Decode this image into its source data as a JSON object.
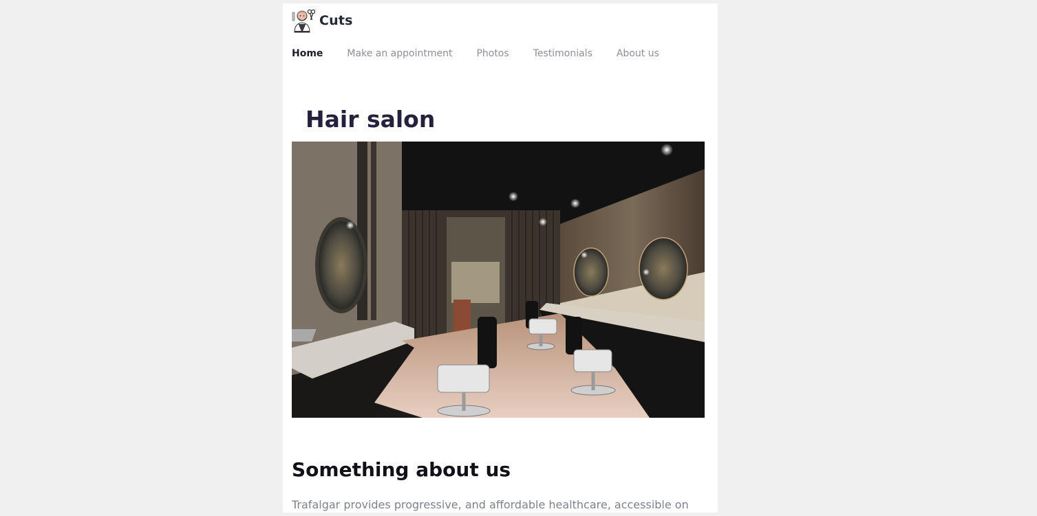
{
  "header": {
    "brand_name": "Cuts",
    "logo_icon": "barber-logo-icon"
  },
  "nav": {
    "items": [
      {
        "label": "Home",
        "active": true
      },
      {
        "label": "Make an appointment",
        "active": false
      },
      {
        "label": "Photos",
        "active": false
      },
      {
        "label": "Testimonials",
        "active": false
      },
      {
        "label": "About us",
        "active": false
      }
    ]
  },
  "hero": {
    "title": "Hair salon",
    "image": "barbershop-interior-photo"
  },
  "about": {
    "title": "Something about us",
    "text": "Trafalgar provides progressive, and affordable healthcare, accessible on"
  },
  "colors": {
    "background": "#f0f0f0",
    "card": "#ffffff",
    "heading": "#23213b",
    "nav_inactive": "#8a8f98",
    "body_text": "#7d828c"
  }
}
